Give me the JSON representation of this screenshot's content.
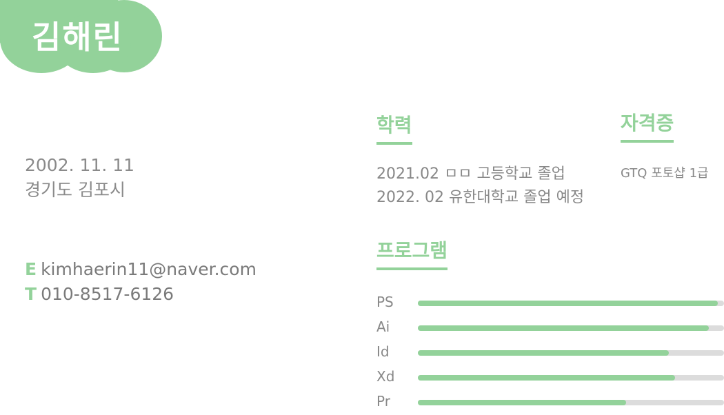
{
  "profile": {
    "name": "김해린",
    "birthdate": "2002. 11. 11",
    "location": "경기도 김포시",
    "email_tag": "E",
    "email": "kimhaerin11@naver.com",
    "phone_tag": "T",
    "phone": "010-8517-6126"
  },
  "education": {
    "heading": "학력",
    "items": [
      "2021.02 ㅁㅁ 고등학교 졸업",
      "2022. 02 유한대학교 졸업 예정"
    ]
  },
  "certificates": {
    "heading": "자격증",
    "items": [
      "GTQ 포토샵 1급"
    ]
  },
  "programs": {
    "heading": "프로그램",
    "items": [
      {
        "label": "PS",
        "level": 0.98
      },
      {
        "label": "Ai",
        "level": 0.95
      },
      {
        "label": "Id",
        "level": 0.82
      },
      {
        "label": "Xd",
        "level": 0.84
      },
      {
        "label": "Pr",
        "level": 0.68
      }
    ]
  },
  "colors": {
    "accent": "#93d29a",
    "track": "#dcdcdc",
    "text": "#888888"
  }
}
